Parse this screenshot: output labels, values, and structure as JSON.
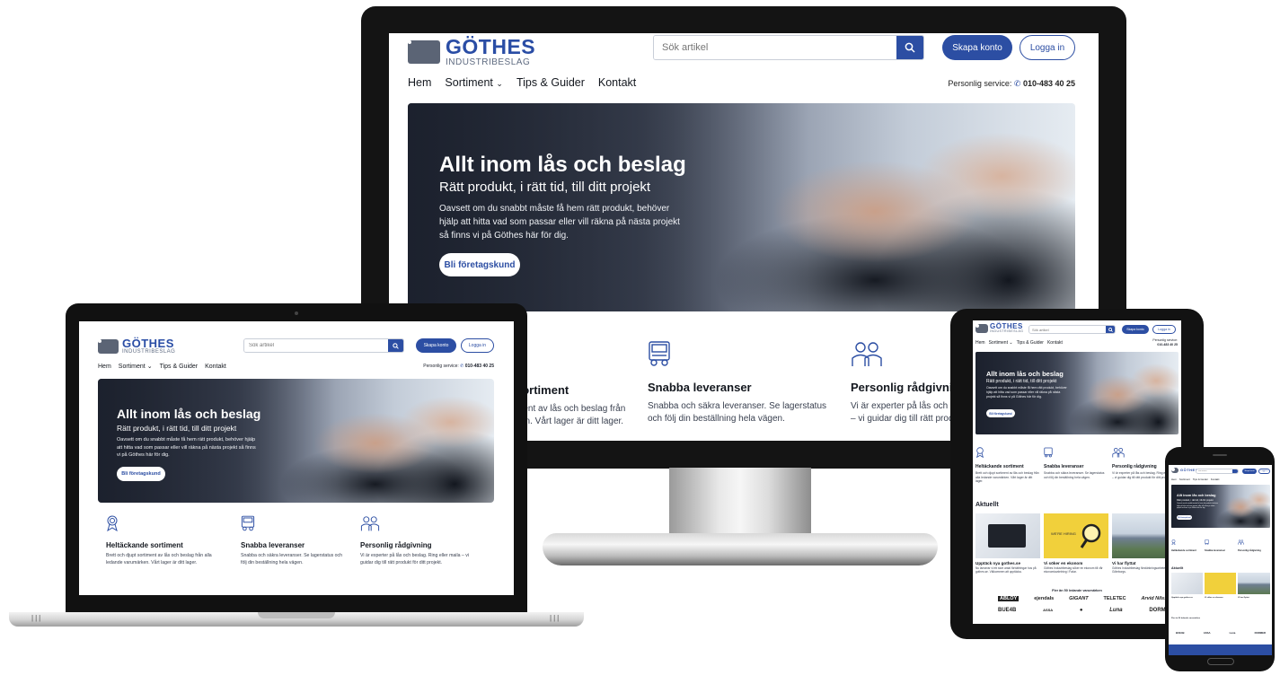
{
  "site": {
    "logo_name": "GÖTHES",
    "logo_sub": "INDUSTRIBESLAG",
    "search_placeholder": "Sök artikel",
    "create_account": "Skapa konto",
    "login": "Logga in",
    "nav": {
      "home": "Hem",
      "assortment": "Sortiment",
      "tips": "Tips & Guider",
      "contact": "Kontakt"
    },
    "service_label": "Personlig service:",
    "service_phone": "010-483 40 25"
  },
  "hero": {
    "title": "Allt inom lås och beslag",
    "subtitle": "Rätt produkt, i rätt tid, till ditt projekt",
    "text": "Oavsett om du snabbt måste få hem rätt produkt, behöver hjälp att hitta vad som passar eller vill räkna på nästa projekt så finns vi på Göthes här för dig.",
    "cta": "Bli företagskund"
  },
  "features": [
    {
      "icon": "award-icon",
      "title": "Heltäckande sortiment",
      "text": "Brett och djupt sortiment av lås och beslag från alla ledande varumärken. Vårt lager är ditt lager."
    },
    {
      "icon": "truck-icon",
      "title": "Snabba leveranser",
      "text": "Snabba och säkra leveranser. Se lagerstatus och följ din beställning hela vägen."
    },
    {
      "icon": "people-icon",
      "title": "Personlig rådgivning",
      "text": "Vi är experter på lås och beslag. Ring eller maila – vi guidar dig till rätt produkt för ditt projekt."
    }
  ],
  "monitor_features": [
    {
      "title": "sortiment",
      "text": "ment av lås och beslag från\nken. Vårt lager är ditt lager."
    },
    {
      "title": "Snabba leveranser",
      "text": "Snabba och säkra leveranser. Se lagerstatus\noch följ din beställning hela vägen."
    },
    {
      "title": "Personlig rådgivni",
      "text": "Vi är experter på lås och b\n– vi guidar dig till rätt prod"
    }
  ],
  "news": {
    "heading": "Aktuellt",
    "items": [
      {
        "title": "Upptäck nya gothes.se",
        "text": "Nu lanserar vi ett stort antal förbättringar hos på gothes.se. Välkommen att upptäcka."
      },
      {
        "title": "Vi söker en ekonom",
        "text": "Göthes Industribeslag söker en ekonom till vår ekonomiavdelning i Falun.",
        "image_text": "WE'RE HIRING"
      },
      {
        "title": "Vi har flyttat",
        "text": "Göthes Industribeslag förstärkningsarbetet i Göteborgs."
      }
    ]
  },
  "brands": {
    "heading": "Fler än 50 ledande varumärken",
    "row1": [
      "ABLOY",
      "ejendals",
      "GIGANT",
      "TELETEC",
      "Arvid Nilsson"
    ],
    "row2": [
      "BUE4B",
      "ASSA",
      "●",
      "Luna",
      "DORMER"
    ]
  },
  "colors": {
    "brand_blue": "#2c4ea3",
    "logo_gray": "#5b6475",
    "hiring_yellow": "#f1d03b"
  }
}
